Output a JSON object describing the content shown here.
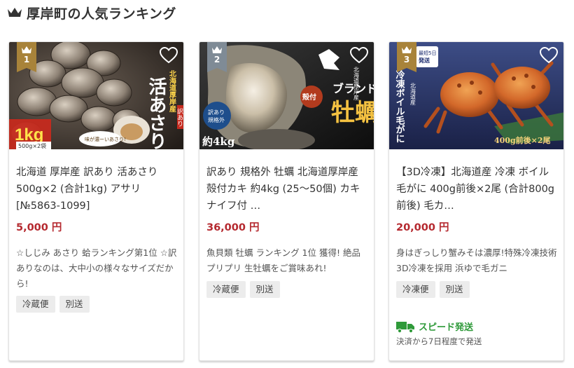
{
  "section": {
    "title": "厚岸町の人気ランキング",
    "icon": "crown-icon"
  },
  "colors": {
    "price": "#b5292f",
    "badge": "#a8833a",
    "speed": "#2f9a3a",
    "tag_bg": "#ececec"
  },
  "cards": [
    {
      "rank": "1",
      "image_texts": {
        "badge_area": "北海道厚岸産",
        "main": "活あさり",
        "tag": "訳あり",
        "weight": "1kg",
        "sub": "500g×2袋",
        "bubble": "味が濃ーいあさり!"
      },
      "title": "北海道 厚岸産 訳あり 活あさり 500g×2 (合計1kg) アサリ[№5863-1099]",
      "price": "5,000 円",
      "desc": "☆しじみ あさり 蛤ランキング第1位 ☆訳ありなのは、大中小の様々なサイズだから!",
      "tags": [
        "冷蔵便",
        "別送"
      ]
    },
    {
      "rank": "2",
      "image_texts": {
        "brand": "ブランド",
        "main": "牡蠣",
        "shell": "殻付",
        "region": "北海道厚岸産",
        "sticker": "訳あり規格外",
        "weight": "約4kg"
      },
      "title": "訳あり 規格外 牡蠣 北海道厚岸産 殻付カキ 約4kg (25〜50個) カキナイフ付 …",
      "price": "36,000 円",
      "desc": "魚貝類 牡蠣 ランキング 1位 獲得! 絶品 プリプリ 生牡蠣をご賞味あれ!",
      "tags": [
        "冷蔵便",
        "別送"
      ]
    },
    {
      "rank": "3",
      "image_texts": {
        "badge": "最短5日発送",
        "vertical": "冷凍ボイル毛がに",
        "region": "北海道産",
        "weight": "400g前後×2尾"
      },
      "title": "【3D冷凍】北海道産 冷凍 ボイル毛がに 400g前後×2尾 (合計800g前後) 毛カ…",
      "price": "20,000 円",
      "desc": "身はぎっしり蟹みそは濃厚!特殊冷凍技術 3D冷凍を採用 浜ゆで毛ガニ",
      "tags": [
        "冷凍便",
        "別送"
      ],
      "speed_label": "スピード発送",
      "speed_note": "決済から7日程度で発送",
      "speed_icon": "truck-icon"
    }
  ]
}
